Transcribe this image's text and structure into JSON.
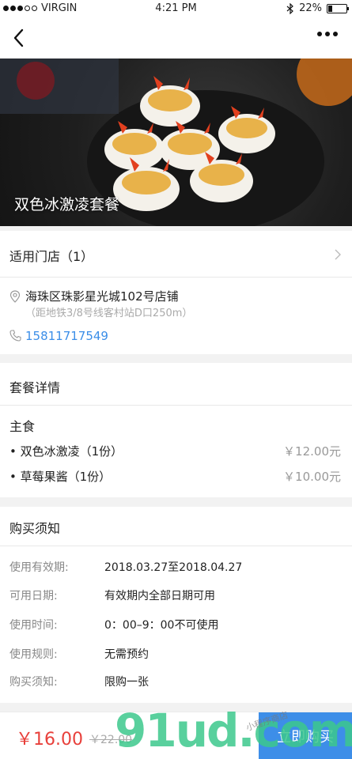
{
  "status": {
    "carrier": "VIRGIN",
    "time": "4:21 PM",
    "battery": "22%",
    "battery_level": 0.22
  },
  "hero": {
    "title": "双色冰激凌套餐"
  },
  "store": {
    "title": "适用门店（1）",
    "address": "海珠区珠影星光城102号店铺",
    "address_note": "（距地铁3/8号线客村站D口250m）",
    "phone": "15811717549"
  },
  "package": {
    "title": "套餐详情",
    "group": "主食",
    "items": [
      {
        "name": "• 双色冰激凌（1份）",
        "price": "￥12.00元"
      },
      {
        "name": "• 草莓果酱（1份）",
        "price": "￥10.00元"
      }
    ]
  },
  "notice": {
    "title": "购买须知",
    "rows": [
      {
        "k": "使用有效期:",
        "v": "2018.03.27至2018.04.27"
      },
      {
        "k": "可用日期:",
        "v": "有效期内全部日期可用"
      },
      {
        "k": "使用时间:",
        "v": "0：00–9：00不可使用"
      },
      {
        "k": "使用规则:",
        "v": "无需预约"
      },
      {
        "k": "购买须知:",
        "v": "限购一张"
      }
    ]
  },
  "footer": {
    "price": "￥16.00",
    "original_price": "￥22.00",
    "buy_label": "立即购买"
  },
  "watermark": {
    "logo": "91ud.com",
    "slogan": "小程序商店"
  },
  "colors": {
    "accent": "#3d8ee8",
    "price": "#e8403b",
    "phone": "#3b8ee8",
    "watermark": "#3cc88c"
  }
}
